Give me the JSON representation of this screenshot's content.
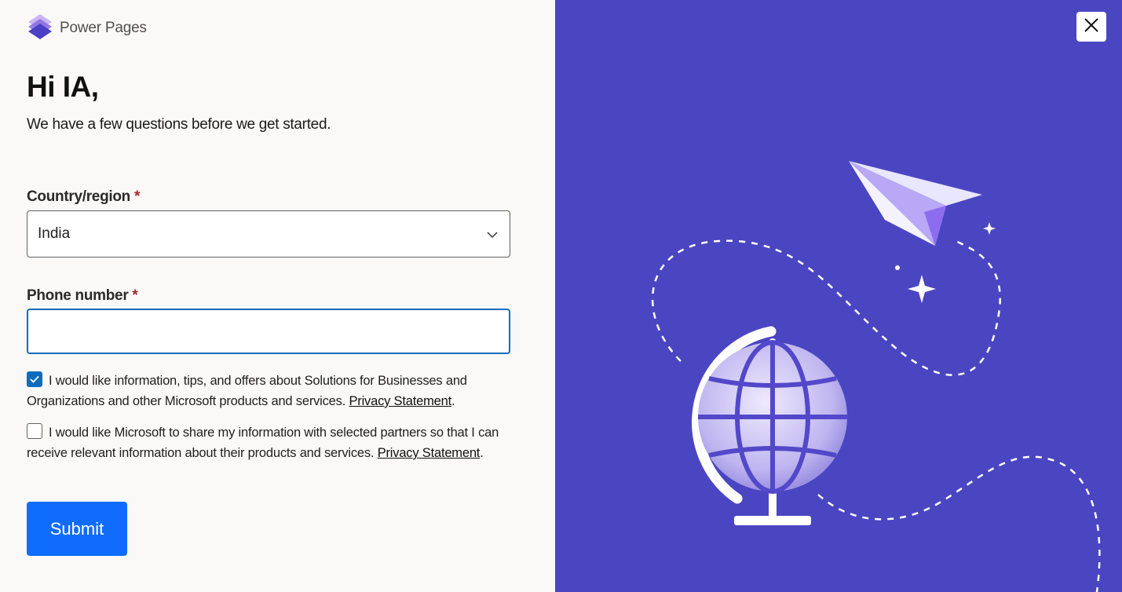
{
  "brand": {
    "name": "Power Pages",
    "logo_icon": "power-pages-logo"
  },
  "form": {
    "greeting": "Hi IA,",
    "subtitle": "We have a few questions before we get started.",
    "country": {
      "label": "Country/region",
      "required_mark": "*",
      "value": "India"
    },
    "phone": {
      "label": "Phone number",
      "required_mark": "*",
      "value": ""
    },
    "consent1": {
      "checked": true,
      "text": "I would like information, tips, and offers about Solutions for Businesses and Organizations and other Microsoft products and services.",
      "link": "Privacy Statement",
      "trail": "."
    },
    "consent2": {
      "checked": false,
      "text": "I would like Microsoft to share my information with selected partners so that I can receive relevant information about their products and services.",
      "link": "Privacy Statement",
      "trail": "."
    },
    "submit_label": "Submit"
  },
  "panel": {
    "background": "#4a46c2",
    "close_icon": "close-icon",
    "illustration": "globe-and-paper-plane"
  },
  "colors": {
    "accent": "#0f6cbd",
    "button": "#0f6cfd",
    "required": "#a4262c"
  }
}
